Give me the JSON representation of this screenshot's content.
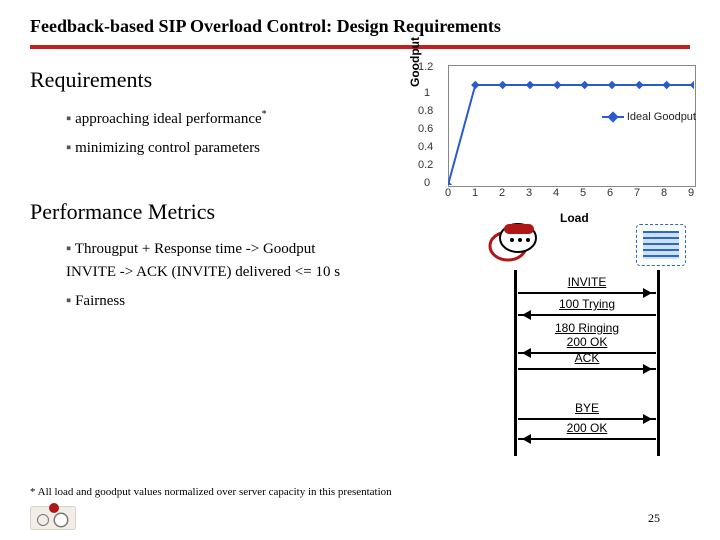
{
  "title": "Feedback-based SIP Overload Control: Design Requirements",
  "sections": {
    "requirements": {
      "heading": "Requirements",
      "items": [
        {
          "text": "approaching ideal performance",
          "sup": "*"
        },
        {
          "text": "minimizing control parameters",
          "sup": ""
        }
      ]
    },
    "metrics": {
      "heading": "Performance Metrics",
      "items": [
        {
          "text": "Througput + Response time -> Goodput",
          "sub": "INVITE -> ACK (INVITE) delivered <= 10 s"
        },
        {
          "text": "Fairness",
          "sub": ""
        }
      ]
    }
  },
  "chart_data": {
    "type": "line",
    "title": "",
    "xlabel": "Load",
    "ylabel": "Goodput",
    "xlim": [
      0,
      9
    ],
    "ylim": [
      0,
      1.2
    ],
    "xticks": [
      0,
      1,
      2,
      3,
      4,
      5,
      6,
      7,
      8,
      9
    ],
    "yticks": [
      0,
      0.2,
      0.4,
      0.6,
      0.8,
      1,
      1.2
    ],
    "series": [
      {
        "name": "Ideal Goodput",
        "color": "#2a5bcc",
        "x": [
          0,
          1,
          2,
          3,
          4,
          5,
          6,
          7,
          8,
          9
        ],
        "y": [
          0,
          1,
          1,
          1,
          1,
          1,
          1,
          1,
          1,
          1
        ]
      }
    ]
  },
  "sip": {
    "messages": [
      "INVITE",
      "100 Trying",
      "180 Ringing",
      "200 OK",
      "ACK",
      "BYE",
      "200 OK"
    ]
  },
  "footnote": "* All load and goodput values normalized over server capacity in this presentation",
  "page": "25"
}
